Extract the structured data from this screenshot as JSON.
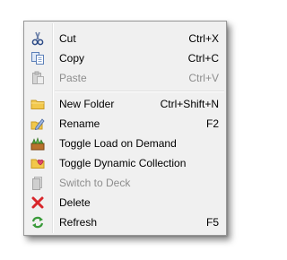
{
  "menu": {
    "items": [
      {
        "label": "Cut",
        "shortcut": "Ctrl+X",
        "enabled": true,
        "icon": "scissors-icon"
      },
      {
        "label": "Copy",
        "shortcut": "Ctrl+C",
        "enabled": true,
        "icon": "copy-icon"
      },
      {
        "label": "Paste",
        "shortcut": "Ctrl+V",
        "enabled": false,
        "icon": "paste-icon"
      },
      {
        "label": "New Folder",
        "shortcut": "Ctrl+Shift+N",
        "enabled": true,
        "icon": "folder-icon"
      },
      {
        "label": "Rename",
        "shortcut": "F2",
        "enabled": true,
        "icon": "rename-icon"
      },
      {
        "label": "Toggle Load on Demand",
        "shortcut": "",
        "enabled": true,
        "icon": "load-on-demand-icon"
      },
      {
        "label": "Toggle Dynamic Collection",
        "shortcut": "",
        "enabled": true,
        "icon": "dynamic-collection-icon"
      },
      {
        "label": "Switch to Deck",
        "shortcut": "",
        "enabled": false,
        "icon": "deck-icon"
      },
      {
        "label": "Delete",
        "shortcut": "",
        "enabled": true,
        "icon": "delete-icon"
      },
      {
        "label": "Refresh",
        "shortcut": "F5",
        "enabled": true,
        "icon": "refresh-icon"
      }
    ]
  },
  "colors": {
    "menu_background": "#f0f0f0",
    "menu_border": "#979797",
    "disabled_text": "#8d8d8d",
    "delete_red": "#d8262b",
    "refresh_green": "#3a9a3a"
  }
}
